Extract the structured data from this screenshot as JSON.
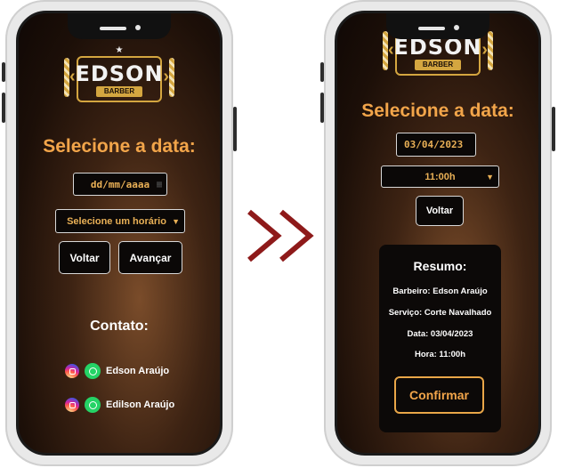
{
  "colors": {
    "accent": "#f2a54a",
    "arrow": "#8e1a1a",
    "gold": "#d4a640"
  },
  "brand": {
    "name": "EDSON",
    "sub": "BARBER",
    "star": "★"
  },
  "left": {
    "title": "Selecione a data:",
    "date_placeholder": "dd/mm/aaaa",
    "time_select": "Selecione um horário",
    "back_label": "Voltar",
    "next_label": "Avançar",
    "contact_title": "Contato:",
    "contacts": [
      {
        "name": "Edson Araújo",
        "icons": [
          "instagram-icon",
          "whatsapp-icon"
        ]
      },
      {
        "name": "Edilson Araújo",
        "icons": [
          "instagram-icon",
          "whatsapp-icon"
        ]
      }
    ]
  },
  "right": {
    "title": "Selecione a data:",
    "date_value": "03/04/2023",
    "time_value": "11:00h",
    "back_label": "Voltar",
    "summary": {
      "title": "Resumo:",
      "barber": "Barbeiro: Edson Araújo",
      "service": "Serviço: Corte Navalhado",
      "date": "Data: 03/04/2023",
      "hour": "Hora: 11:00h"
    },
    "confirm_label": "Confirmar"
  }
}
